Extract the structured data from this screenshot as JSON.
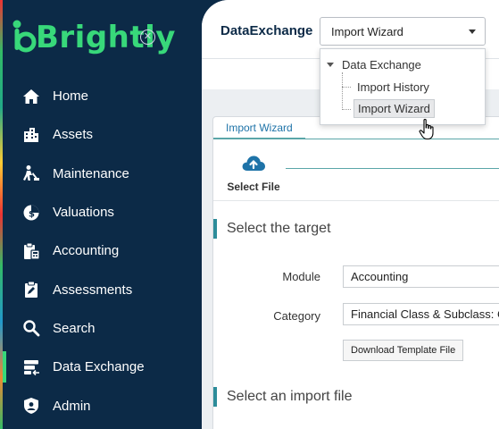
{
  "brand": {
    "logo_text": "Brightly",
    "logo_color": "#38d87a"
  },
  "sidebar": {
    "items": [
      {
        "label": "Home",
        "icon": "home-icon"
      },
      {
        "label": "Assets",
        "icon": "building-icon"
      },
      {
        "label": "Maintenance",
        "icon": "worker-icon"
      },
      {
        "label": "Valuations",
        "icon": "valuation-icon"
      },
      {
        "label": "Accounting",
        "icon": "clipboard-calculator-icon"
      },
      {
        "label": "Assessments",
        "icon": "clipboard-edit-icon"
      },
      {
        "label": "Search",
        "icon": "search-icon"
      },
      {
        "label": "Data Exchange",
        "icon": "data-exchange-icon",
        "active": true
      },
      {
        "label": "Admin",
        "icon": "shield-user-icon"
      }
    ]
  },
  "header": {
    "title": "DataExchange",
    "select_value": "Import Wizard"
  },
  "dropdown": {
    "root": "Data Exchange",
    "children": [
      "Import History",
      "Import Wizard"
    ],
    "selected": "Import Wizard"
  },
  "card": {
    "tab": "Import Wizard",
    "step_label": "Select File",
    "section_target": "Select the target",
    "module_label": "Module",
    "module_value": "Accounting",
    "category_label": "Category",
    "category_value": "Financial Class & Subclass: Cr",
    "template_button": "Download Template File",
    "section_import": "Select an import file"
  },
  "colors": {
    "sidebar_bg": "#0c2a47",
    "accent_green": "#38d87a",
    "teal": "#2c8c9a",
    "link_blue": "#1e73a8"
  }
}
